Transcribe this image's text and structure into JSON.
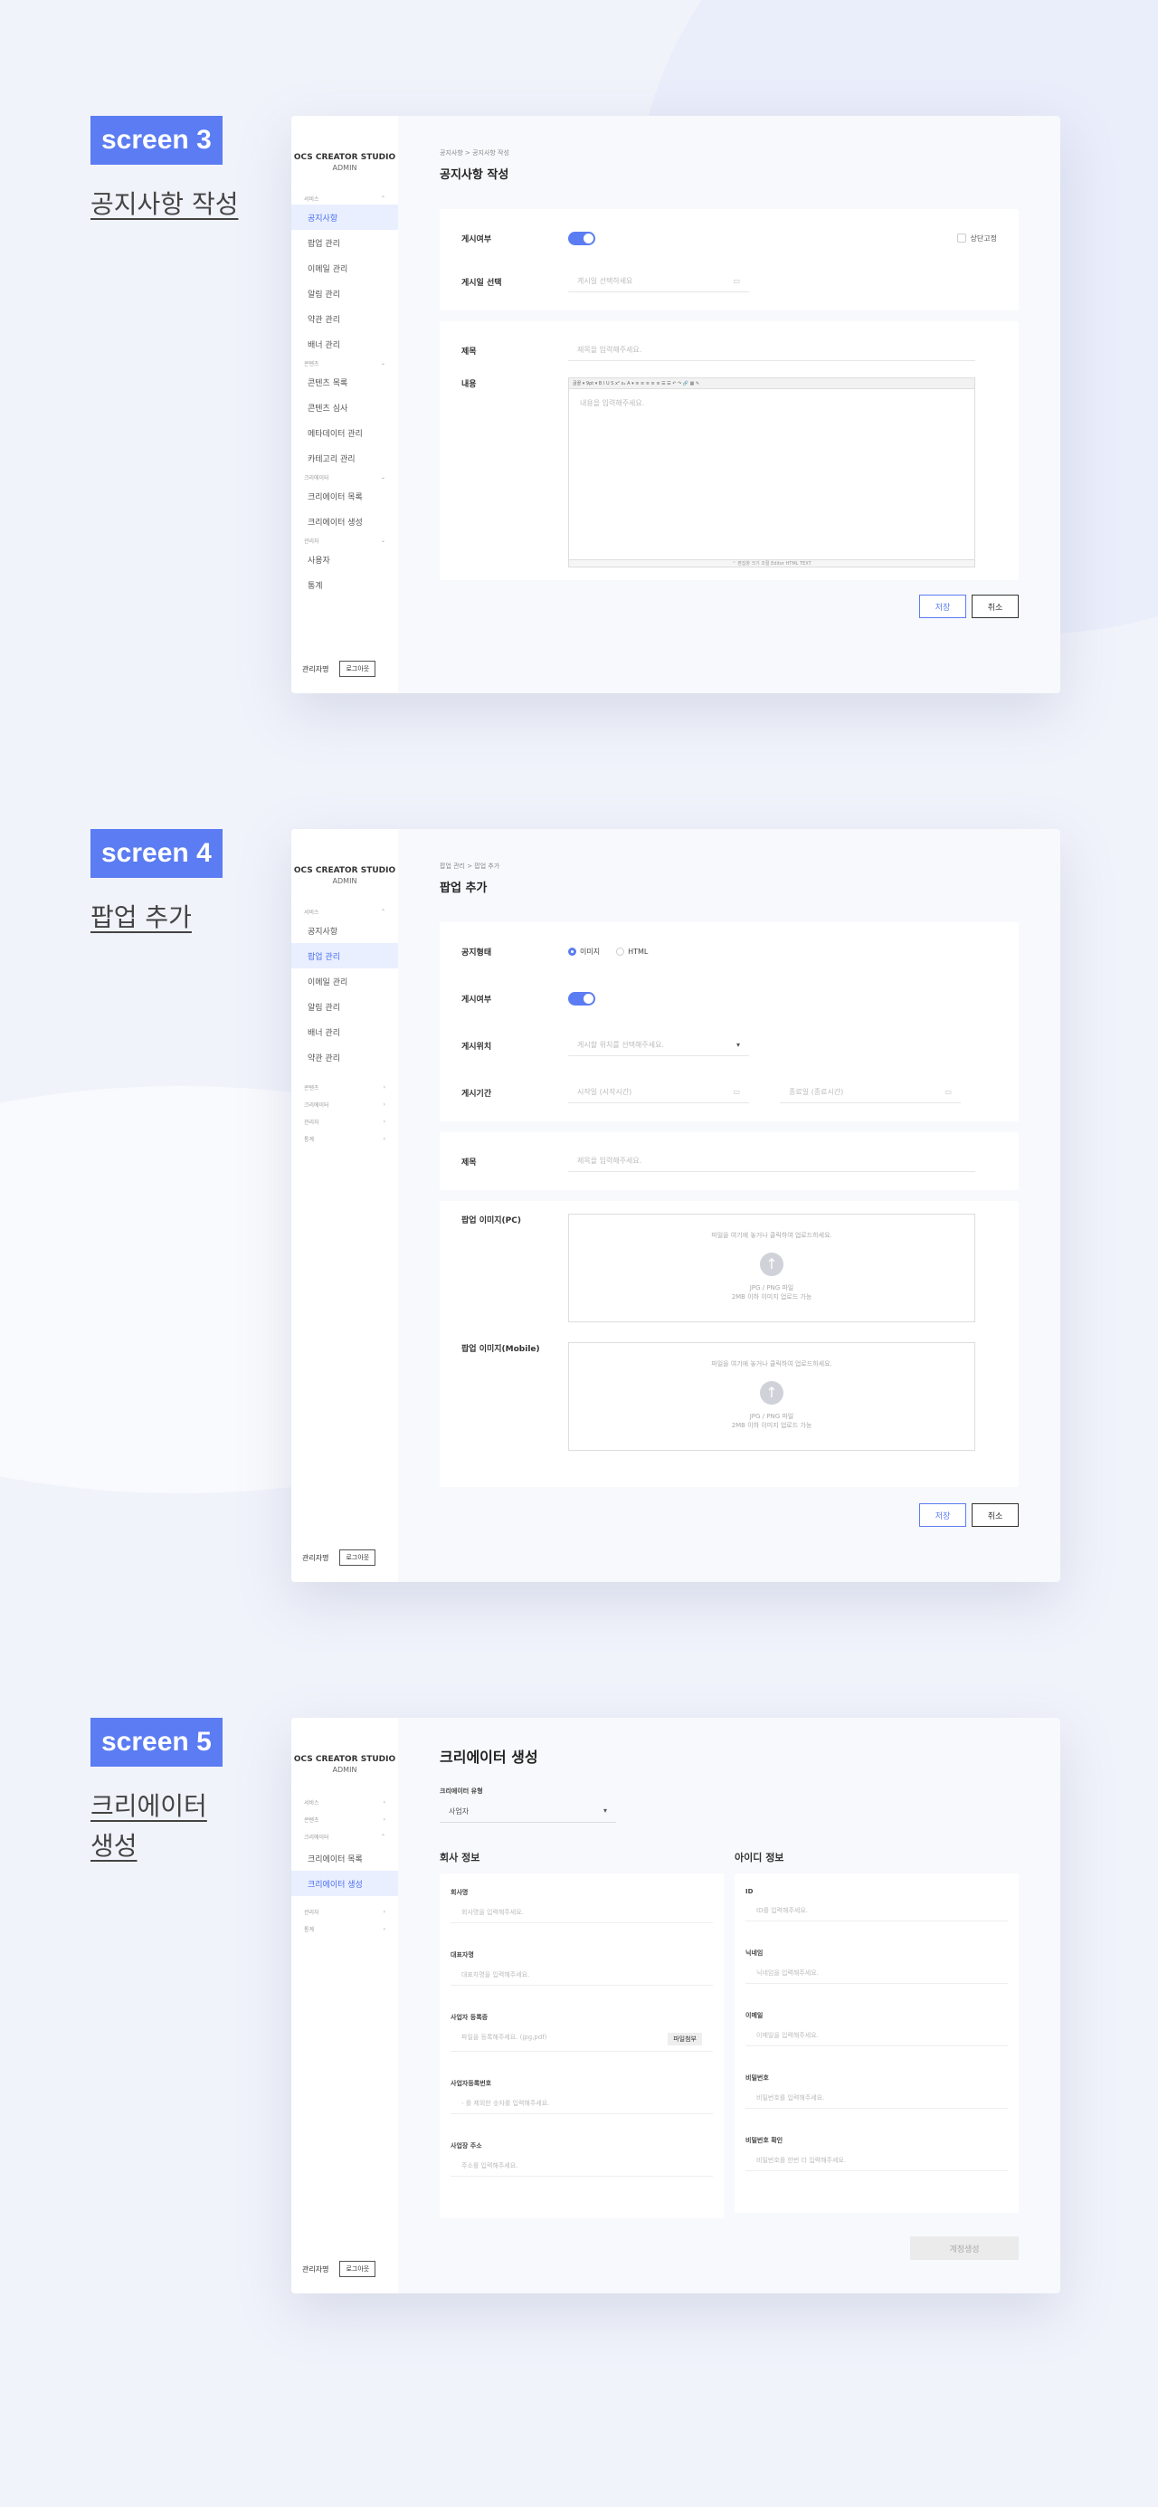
{
  "s3": {
    "badge": "screen 3",
    "title": "공지사항 작성",
    "sidebar": {
      "logo1": "OCS CREATOR STUDIO",
      "logo2": "ADMIN",
      "g1": "서비스",
      "items1": [
        "공지사항",
        "팝업 관리",
        "이메일 관리",
        "알림 관리",
        "약관 관리",
        "배너 관리"
      ],
      "g2": "콘텐츠",
      "items2": [
        "콘텐츠 목록",
        "콘텐츠 심사",
        "메타데이터 관리",
        "카테고리 관리"
      ],
      "g3": "크리에이터",
      "items3": [
        "크리에이터 목록",
        "크리에이터 생성"
      ],
      "g4": "관리자",
      "items4": [
        "사용자",
        "통계"
      ],
      "admin": "관리자명",
      "logout": "로그아웃"
    },
    "breadcrumb": "공지사항  >  공지사항 작성",
    "pageTitle": "공지사항 작성",
    "pubLabel": "게시여부",
    "pinLabel": "상단고정",
    "dateLabel": "게시일 선택",
    "datePh": "게시일 선택하세요",
    "titleLabel": "제목",
    "titlePh": "제목을 입력해주세요.",
    "contentLabel": "내용",
    "contentPh": "내용을 입력해주세요.",
    "toolbar": "글꼴 ▾  9pt ▾  B I U S x² x₂ A ▾  ≡ ≡ ≡ ≡ ≡  ☰ ☰  ↶ ↷  🔗 ▦ ✎",
    "editorFoot": "⌃ 편집창 크기 조절   Editor  HTML  TEXT",
    "save": "저장",
    "cancel": "취소"
  },
  "s4": {
    "badge": "screen 4",
    "title": "팝업 추가",
    "sidebar": {
      "logo1": "OCS CREATOR STUDIO",
      "logo2": "ADMIN",
      "g1": "서비스",
      "items1": [
        "공지사항",
        "팝업 관리",
        "이메일 관리",
        "알림 관리",
        "배너 관리",
        "약관 관리"
      ],
      "groups": [
        "콘텐츠",
        "크리에이터",
        "관리자",
        "통계"
      ],
      "admin": "관리자명",
      "logout": "로그아웃"
    },
    "breadcrumb": "팝업 관리  >  팝업 추가",
    "pageTitle": "팝업 추가",
    "typeLabel": "공지형태",
    "opt1": "이미지",
    "opt2": "HTML",
    "pubLabel": "게시여부",
    "posLabel": "게시위치",
    "posPh": "게시할 위치를 선택해주세요.",
    "periodLabel": "게시기간",
    "startPh": "시작일 (시작시간)",
    "endPh": "종료일 (종료시간)",
    "titleLabel": "제목",
    "titlePh": "제목을 입력해주세요.",
    "pcLabel": "팝업 이미지(PC)",
    "mLabel": "팝업 이미지(Mobile)",
    "uplText": "파일을 여기에 놓거나 클릭하여 업로드하세요.",
    "uplFmt": "JPG / PNG 파일",
    "uplSize": "2MB 이하 이미지 업로드 가능",
    "save": "저장",
    "cancel": "취소"
  },
  "s5": {
    "badge": "screen 5",
    "title1": "크리에이터",
    "title2": "생성",
    "sidebar": {
      "logo1": "OCS CREATOR STUDIO",
      "logo2": "ADMIN",
      "groups1": [
        "서비스",
        "콘텐츠",
        "크리에이터"
      ],
      "items": [
        "크리에이터 목록",
        "크리에이터 생성"
      ],
      "groups2": [
        "관리자",
        "통계"
      ],
      "admin": "관리자명",
      "logout": "로그아웃"
    },
    "pageTitle": "크리에이터 생성",
    "typeLabel": "크리에이터 유형",
    "typeVal": "사업자",
    "companyTitle": "회사 정보",
    "idTitle": "아이디 정보",
    "company": [
      {
        "l": "회사명",
        "p": "회사명을 입력해주세요."
      },
      {
        "l": "대표자명",
        "p": "대표자명을 입력해주세요."
      },
      {
        "l": "사업자 등록증",
        "p": "파일을 등록해주세요. (jpg,pdf)"
      },
      {
        "l": "사업자등록번호",
        "p": "- 를 제외한 숫자를 입력해주세요."
      },
      {
        "l": "사업장 주소",
        "p": "주소를 입력해주세요."
      }
    ],
    "fileBtn": "파일첨부",
    "ident": [
      {
        "l": "ID",
        "p": "ID를 입력해주세요."
      },
      {
        "l": "닉네임",
        "p": "닉네임을 입력해주세요."
      },
      {
        "l": "이메일",
        "p": "이메일을 입력해주세요."
      },
      {
        "l": "비밀번호",
        "p": "비밀번호를 입력해주세요."
      },
      {
        "l": "비밀번호 확인",
        "p": "비밀번호를 한번 더 입력해주세요."
      }
    ],
    "create": "계정생성"
  }
}
